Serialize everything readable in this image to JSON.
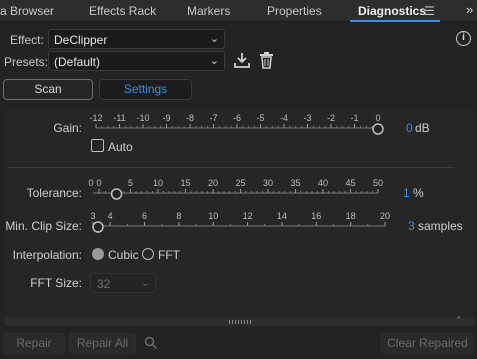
{
  "tabs": [
    {
      "label": "a Browser",
      "active": false
    },
    {
      "label": "Effects Rack",
      "active": false
    },
    {
      "label": "Markers",
      "active": false
    },
    {
      "label": "Properties",
      "active": false
    },
    {
      "label": "Diagnostics",
      "active": true
    }
  ],
  "tab_menu_glyph": "☰",
  "tab_overflow_glyph": "»",
  "effect": {
    "label": "Effect:",
    "value": "DeClipper"
  },
  "presets": {
    "label": "Presets:",
    "value": "(Default)"
  },
  "modes": {
    "scan": "Scan",
    "settings": "Settings",
    "selected": "Settings"
  },
  "gain": {
    "label": "Gain:",
    "value": "0",
    "unit": "dB",
    "ticks": [
      "-12",
      "-11",
      "-10",
      "-9",
      "-8",
      "-7",
      "-6",
      "-5",
      "-4",
      "-3",
      "-2",
      "-1",
      "0"
    ],
    "min": -12,
    "max": 0,
    "current": 0
  },
  "auto": {
    "label": "Auto",
    "checked": false
  },
  "tolerance": {
    "label": "Tolerance:",
    "value": "1",
    "unit": "%",
    "ticks": [
      "0",
      "0",
      "5",
      "10",
      "15",
      "20",
      "25",
      "30",
      "35",
      "40",
      "45",
      "50"
    ],
    "min": 0,
    "max": 50,
    "current": 1
  },
  "min_clip": {
    "label": "Min. Clip Size:",
    "value": "3",
    "unit": "samples",
    "ticks": [
      "3",
      "4",
      "6",
      "8",
      "10",
      "12",
      "14",
      "16",
      "18",
      "20"
    ],
    "min": 3,
    "max": 20,
    "current": 3
  },
  "interpolation": {
    "label": "Interpolation:",
    "options": [
      "Cubic",
      "FFT"
    ],
    "selected": "Cubic"
  },
  "fft_size": {
    "label": "FFT Size:",
    "value": "32"
  },
  "footer": {
    "repair": "Repair",
    "repair_all": "Repair All",
    "clear_repaired": "Clear Repaired"
  },
  "colors": {
    "accent": "#3b8ee8",
    "background": "#232323"
  }
}
